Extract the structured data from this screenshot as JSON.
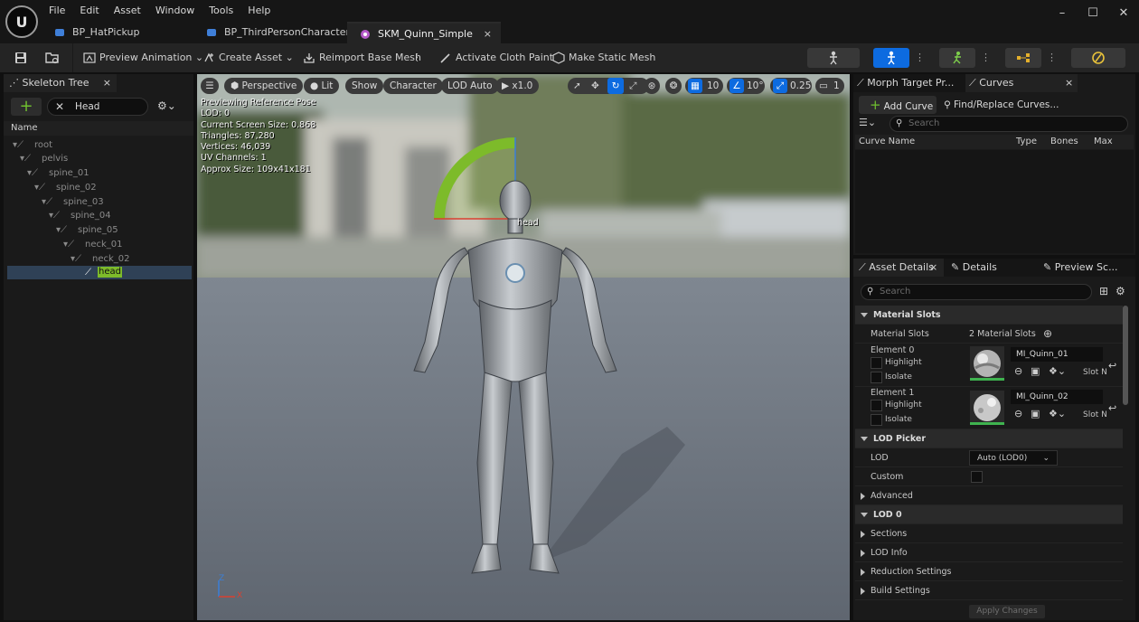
{
  "menu": [
    "File",
    "Edit",
    "Asset",
    "Window",
    "Tools",
    "Help"
  ],
  "tabs": [
    {
      "label": "BP_HatPickup"
    },
    {
      "label": "BP_ThirdPersonCharacter"
    },
    {
      "label": "SKM_Quinn_Simple",
      "close": "×"
    }
  ],
  "window_controls": {
    "minimize": "–",
    "maximize": "☐",
    "close": "✕"
  },
  "toolbar": {
    "preview_animation": "Preview Animation",
    "create_asset": "Create Asset",
    "reimport": "Reimport Base Mesh",
    "cloth_paint": "Activate Cloth Paint",
    "static_mesh": "Make Static Mesh"
  },
  "skeleton_tree": {
    "tab_label": "Skeleton Tree",
    "tab_close": "×",
    "search_value": "Head",
    "column": "Name",
    "bones": [
      "root",
      "pelvis",
      "spine_01",
      "spine_02",
      "spine_03",
      "spine_04",
      "spine_05",
      "neck_01",
      "neck_02",
      "head"
    ]
  },
  "viewport": {
    "perspective": "Perspective",
    "lit": "Lit",
    "show": "Show",
    "character": "Character",
    "lod": "LOD Auto",
    "play_rate": "x1.0",
    "grid_snap": "10",
    "angle_snap": "10°",
    "scale_snap": "0.25",
    "camera_speed": "1",
    "stats": [
      "Previewing Reference Pose",
      "LOD: 0",
      "Current Screen Size: 0.868",
      "Triangles: 87,280",
      "Vertices: 46,039",
      "UV Channels: 1",
      "Approx Size: 109x41x181"
    ],
    "bone_label": "head",
    "axis_z": "Z",
    "axis_x": "X"
  },
  "curves_panel": {
    "tab_morph": "Morph Target Pr...",
    "tab_curves": "Curves",
    "tab_close": "×",
    "add_curve": "Add Curve",
    "find_replace": "Find/Replace Curves...",
    "search_placeholder": "Search",
    "columns": [
      "Curve Name",
      "Type",
      "Bones",
      "Max LOD"
    ]
  },
  "details_panel": {
    "tab_asset_details": "Asset Details",
    "tab_asset_close": "×",
    "tab_details": "Details",
    "tab_preview": "Preview Sc...",
    "search_placeholder": "Search",
    "material_slots_header": "Material Slots",
    "material_slots_label": "Material Slots",
    "material_slots_value": "2 Material Slots",
    "elements": [
      {
        "label": "Element 0",
        "highlight": "Highlight",
        "isolate": "Isolate",
        "material": "MI_Quinn_01",
        "slot": "Slot N"
      },
      {
        "label": "Element 1",
        "highlight": "Highlight",
        "isolate": "Isolate",
        "material": "MI_Quinn_02",
        "slot": "Slot N"
      }
    ],
    "lod_picker_header": "LOD Picker",
    "lod_label": "LOD",
    "lod_value": "Auto (LOD0)",
    "custom_label": "Custom",
    "advanced": "Advanced",
    "lod0_header": "LOD 0",
    "sections": "Sections",
    "lod_info": "LOD Info",
    "reduction_settings": "Reduction Settings",
    "build_settings": "Build Settings",
    "apply_changes": "Apply Changes"
  },
  "colors": {
    "accent_blue": "#0d6be0",
    "selection": "#2f4156",
    "gizmo_green": "#7dbb2a",
    "add_green": "#6fbf2f"
  }
}
